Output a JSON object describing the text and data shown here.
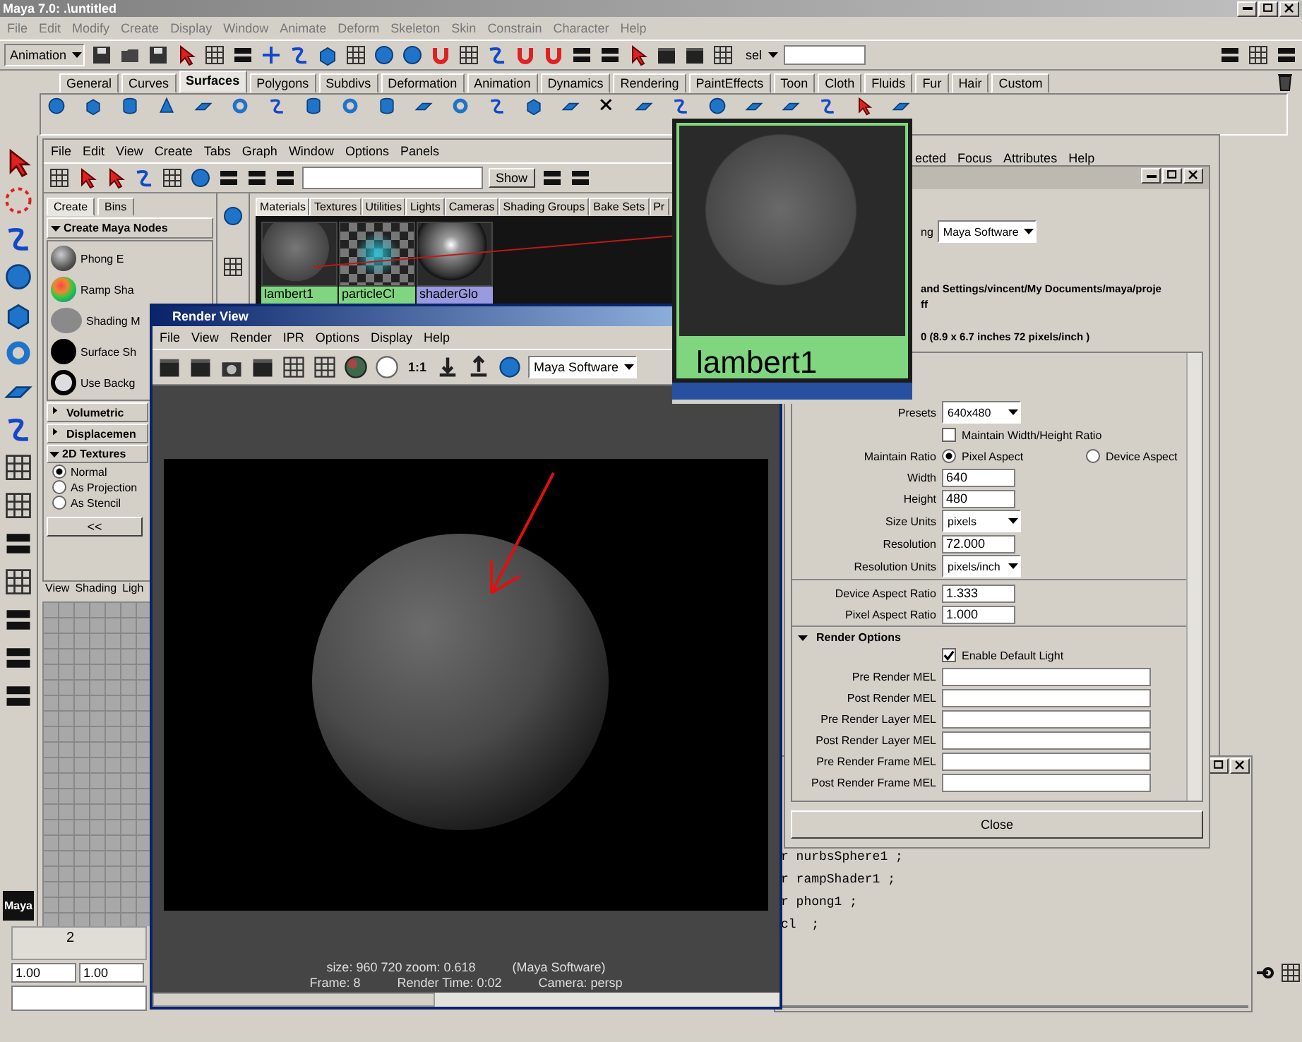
{
  "window": {
    "title": "Maya 7.0: .\\untitled"
  },
  "menu": [
    "File",
    "Edit",
    "Modify",
    "Create",
    "Display",
    "Window",
    "Animate",
    "Deform",
    "Skeleton",
    "Skin",
    "Constrain",
    "Character",
    "Help"
  ],
  "toolbar": {
    "mode": "Animation",
    "selection_label": "sel"
  },
  "shelf_tabs": [
    {
      "label": "General",
      "selected": false
    },
    {
      "label": "Curves",
      "selected": false
    },
    {
      "label": "Surfaces",
      "selected": true
    },
    {
      "label": "Polygons",
      "selected": false
    },
    {
      "label": "Subdivs",
      "selected": false
    },
    {
      "label": "Deformation",
      "selected": false
    },
    {
      "label": "Animation",
      "selected": false
    },
    {
      "label": "Dynamics",
      "selected": false
    },
    {
      "label": "Rendering",
      "selected": false
    },
    {
      "label": "PaintEffects",
      "selected": false
    },
    {
      "label": "Toon",
      "selected": false
    },
    {
      "label": "Cloth",
      "selected": false
    },
    {
      "label": "Fluids",
      "selected": false
    },
    {
      "label": "Fur",
      "selected": false
    },
    {
      "label": "Hair",
      "selected": false
    },
    {
      "label": "Custom",
      "selected": false
    }
  ],
  "hypershade": {
    "menu": [
      "File",
      "Edit",
      "View",
      "Create",
      "Tabs",
      "Graph",
      "Window",
      "Options",
      "Panels"
    ],
    "show_button": "Show",
    "side_tabs": [
      {
        "label": "Create",
        "selected": true
      },
      {
        "label": "Bins",
        "selected": false
      }
    ],
    "create_header": "Create Maya Nodes",
    "nodes": [
      {
        "kind": "phong",
        "label": "Phong E"
      },
      {
        "kind": "ramp",
        "label": "Ramp Sha"
      },
      {
        "kind": "flat",
        "label": "Shading M"
      },
      {
        "kind": "black",
        "label": "Surface Sh"
      },
      {
        "kind": "ring",
        "label": "Use Backg"
      }
    ],
    "sections": [
      {
        "label": "Volumetric",
        "expanded": false
      },
      {
        "label": "Displacemen",
        "expanded": false
      },
      {
        "label": "2D Textures",
        "expanded": true
      }
    ],
    "placement": [
      {
        "label": "Normal",
        "selected": true
      },
      {
        "label": "As Projection",
        "selected": false
      },
      {
        "label": "As Stencil",
        "selected": false
      }
    ],
    "collapse_button": "<<",
    "tabs": [
      {
        "label": "Materials",
        "selected": true
      },
      {
        "label": "Textures",
        "selected": false
      },
      {
        "label": "Utilities",
        "selected": false
      },
      {
        "label": "Lights",
        "selected": false
      },
      {
        "label": "Cameras",
        "selected": false
      },
      {
        "label": "Shading Groups",
        "selected": false
      },
      {
        "label": "Bake Sets",
        "selected": false
      },
      {
        "label": "Pr",
        "selected": false
      }
    ],
    "swatches": [
      {
        "kind": "matte",
        "label": "lambert1",
        "color": "#7fd67f"
      },
      {
        "kind": "checker",
        "label": "particleCl",
        "color": "#7fd67f"
      },
      {
        "kind": "shiny",
        "label": "shaderGlo",
        "color": "#9a9ae0"
      }
    ]
  },
  "model_panel": {
    "menu": [
      "View",
      "Shading",
      "Ligh"
    ]
  },
  "logo": "Maya",
  "inset": {
    "label": "lambert1"
  },
  "attribute_editor": {
    "menu": [
      "ected",
      "Focus",
      "Attributes",
      "Help"
    ]
  },
  "render_settings": {
    "renderer_label": "ng",
    "renderer": "Maya Software",
    "path": "and Settings/vincent/My Documents/maya/proje",
    "file_fragment": "ff",
    "resolution_info": "0 (8.9 x 6.7 inches 72 pixels/inch )",
    "rows": [
      {
        "kind": "dropdown",
        "label": "Presets",
        "value": "640x480"
      },
      {
        "kind": "checkbox",
        "label": "Maintain Width/Height Ratio",
        "checked": false
      },
      {
        "kind": "radio",
        "label": "Maintain Ratio",
        "options": [
          {
            "label": "Pixel Aspect",
            "selected": true
          },
          {
            "label": "Device Aspect",
            "selected": false
          }
        ]
      },
      {
        "kind": "field",
        "label": "Width",
        "value": "640"
      },
      {
        "kind": "field",
        "label": "Height",
        "value": "480"
      },
      {
        "kind": "dropdown",
        "label": "Size Units",
        "value": "pixels"
      },
      {
        "kind": "field",
        "label": "Resolution",
        "value": "72.000"
      },
      {
        "kind": "dropdown",
        "label": "Resolution Units",
        "value": "pixels/inch"
      },
      {
        "kind": "field",
        "label": "Device Aspect Ratio",
        "value": "1.333"
      },
      {
        "kind": "field",
        "label": "Pixel Aspect Ratio",
        "value": "1.000"
      }
    ],
    "section": {
      "label": "Render Options",
      "expanded": true
    },
    "default_light": {
      "label": "Enable Default Light",
      "checked": true
    },
    "mel_fields": [
      "Pre Render MEL",
      "Post Render MEL",
      "Pre Render Layer MEL",
      "Post Render Layer MEL",
      "Pre Render Frame MEL",
      "Post Render Frame MEL"
    ],
    "close_button": "Close"
  },
  "script_editor": {
    "lines": [
      "r nurbsSphere1 ;",
      "r rampShader1 ;",
      "r phong1 ;",
      "cl  ;"
    ]
  },
  "render_view": {
    "title": "Render View",
    "menu": [
      "File",
      "View",
      "Render",
      "IPR",
      "Options",
      "Display",
      "Help"
    ],
    "ratio_button": "1:1",
    "renderer": "Maya Software",
    "status": [
      [
        "size:  960  720 zoom: 0.618",
        "(Maya Software)"
      ],
      [
        "Frame: 8",
        "Render Time: 0:02",
        "Camera: persp"
      ]
    ]
  },
  "time_slider": {
    "tick": "2"
  },
  "range": {
    "start": "1.00",
    "end": "1.00"
  }
}
